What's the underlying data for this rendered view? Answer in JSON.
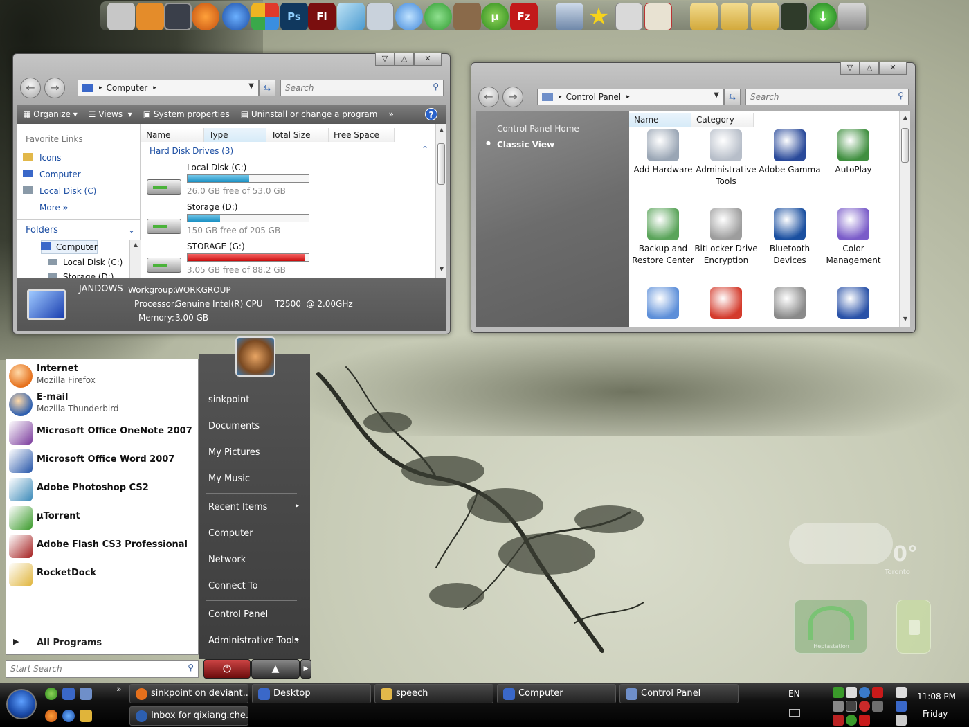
{
  "dock": {
    "icons": [
      "finder-icon",
      "home-icon",
      "terminal-icon",
      "firefox-icon",
      "network-icon",
      "office-icon",
      "photoshop-icon",
      "flash-icon",
      "notebook-icon",
      "calculator-icon",
      "itunes-icon",
      "messenger-icon",
      "rabbit-icon",
      "utorrent-icon",
      "filezilla-icon",
      "drive-icon",
      "star-icon",
      "printer-icon",
      "acrobat-icon",
      "folder-icon",
      "folder-icon",
      "folder-icon",
      "phone-icon",
      "download-icon",
      "trash-icon"
    ],
    "ps_label": "Ps",
    "fl_label": "Fl",
    "fz_label": "Fz",
    "ut_label": "µ"
  },
  "computer_window": {
    "address": "Computer",
    "search_placeholder": "Search",
    "toolbar": {
      "organize": "Organize",
      "views": "Views",
      "system_properties": "System properties",
      "uninstall": "Uninstall or change a program",
      "more": "»"
    },
    "favorite_links": {
      "title": "Favorite Links",
      "items": [
        "Icons",
        "Computer",
        "Local Disk (C)"
      ],
      "more": "More"
    },
    "folders": {
      "title": "Folders",
      "tree": [
        "Computer",
        "Local Disk (C:)",
        "Storage (D:)"
      ]
    },
    "columns": [
      "Name",
      "Type",
      "Total Size",
      "Free Space"
    ],
    "group": "Hard Disk Drives (3)",
    "drives": [
      {
        "name": "Local Disk (C:)",
        "free": "26.0 GB free of 53.0 GB",
        "used_fraction": 0.51
      },
      {
        "name": "Storage (D:)",
        "free": "150 GB free of 205 GB",
        "used_fraction": 0.27
      },
      {
        "name": "STORAGE (G:)",
        "free": "3.05 GB free of 88.2 GB",
        "used_fraction": 0.97
      }
    ],
    "details": {
      "name": "JANDOWS",
      "workgroup_label": "Workgroup:",
      "workgroup": "WORKGROUP",
      "processor_label": "Processor:",
      "processor": "Genuine Intel(R) CPU",
      "processor_model": "T2500  @ 2.00GHz",
      "memory_label": "Memory:",
      "memory": "3.00 GB"
    }
  },
  "control_panel": {
    "address": "Control Panel",
    "search_placeholder": "Search",
    "nav": {
      "home": "Control Panel Home",
      "classic": "Classic View"
    },
    "columns": [
      "Name",
      "Category"
    ],
    "items": [
      "Add Hardware",
      "Administrative Tools",
      "Adobe Gamma",
      "AutoPlay",
      "Backup and Restore Center",
      "BitLocker Drive Encryption",
      "Bluetooth Devices",
      "Color Management"
    ],
    "item_colors": [
      "#9aa6b5",
      "#b7bec9",
      "#2a4a9a",
      "#3f8f3f",
      "#5aa45a",
      "#9d9d9d",
      "#1a4fa0",
      "#7a5cc9",
      "#5d8fd9",
      "#d43b2c",
      "#8a8a8a",
      "#2a52a8"
    ]
  },
  "start_menu": {
    "pinned": [
      {
        "title": "Internet",
        "subtitle": "Mozilla Firefox",
        "color": "#e5701c"
      },
      {
        "title": "E-mail",
        "subtitle": "Mozilla Thunderbird",
        "color": "#2d5fb0"
      }
    ],
    "recent": [
      {
        "title": "Microsoft Office OneNote 2007",
        "color": "#7a3a9c"
      },
      {
        "title": "Microsoft Office Word 2007",
        "color": "#2454a8"
      },
      {
        "title": "Adobe Photoshop CS2",
        "color": "#3a89b8"
      },
      {
        "title": "µTorrent",
        "color": "#3a9a2a"
      },
      {
        "title": "Adobe Flash CS3 Professional",
        "color": "#a41e1e"
      },
      {
        "title": "RocketDock",
        "color": "#e0b43a"
      }
    ],
    "all_programs": "All Programs",
    "search_placeholder": "Start Search",
    "right": [
      "sinkpoint",
      "Documents",
      "My Pictures",
      "My Music",
      "Recent Items",
      "Computer",
      "Network",
      "Connect To",
      "Control Panel",
      "Administrative Tools"
    ]
  },
  "taskbar": {
    "buttons": [
      "sinkpoint on deviant...",
      "Desktop",
      "speech",
      "Computer",
      "Control Panel",
      "Inbox for qixiang.che..."
    ],
    "language": "EN",
    "time": "11:08 PM",
    "day": "Friday",
    "qlaunch_more": "»"
  },
  "gadgets": {
    "weather_temp": "0°",
    "weather_city": "Toronto",
    "wifi_label": "Heptastation"
  }
}
